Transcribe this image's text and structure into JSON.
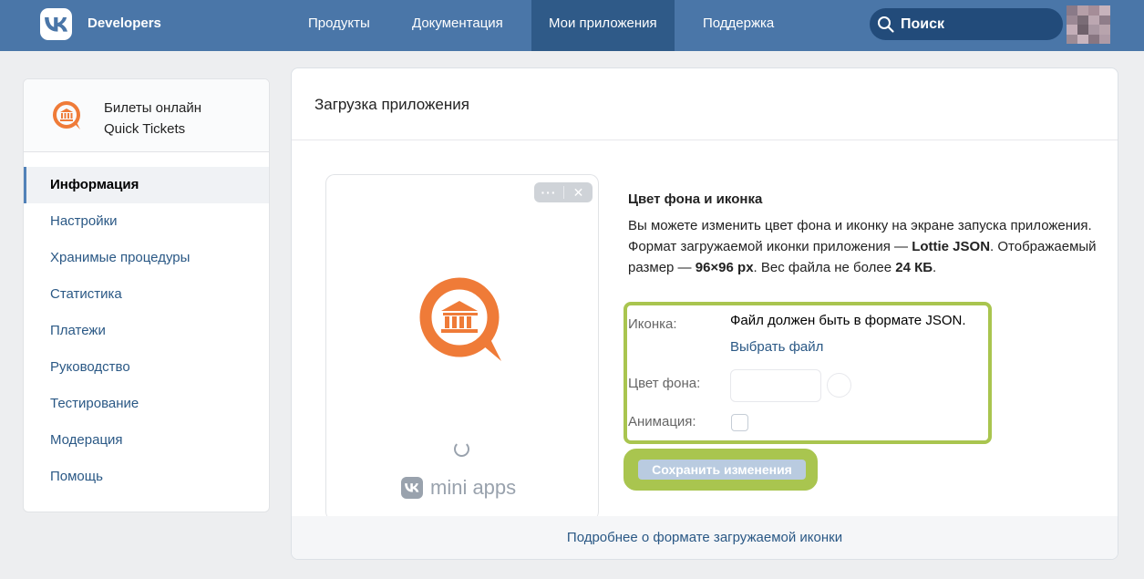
{
  "header": {
    "brand": "Developers",
    "nav": [
      {
        "label": "Продукты"
      },
      {
        "label": "Документация"
      },
      {
        "label": "Мои приложения",
        "active": true
      },
      {
        "label": "Поддержка"
      }
    ],
    "search_placeholder": "Поиск"
  },
  "sidebar": {
    "app_name_ru": "Билеты онлайн",
    "app_name_en": "Quick Tickets",
    "items": [
      {
        "label": "Информация",
        "active": true
      },
      {
        "label": "Настройки"
      },
      {
        "label": "Хранимые процедуры"
      },
      {
        "label": "Статистика"
      },
      {
        "label": "Платежи"
      },
      {
        "label": "Руководство"
      },
      {
        "label": "Тестирование"
      },
      {
        "label": "Модерация"
      },
      {
        "label": "Помощь"
      }
    ]
  },
  "main": {
    "title": "Загрузка приложения",
    "preview": {
      "more_label": "···",
      "close_label": "✕",
      "brand_text": "mini apps"
    },
    "section_title": "Цвет фона и иконка",
    "desc": {
      "part1": "Вы можете изменить цвет фона и иконку на экране запуска приложения. Формат загружаемой иконки приложения — ",
      "format": "Lottie JSON",
      "part2": ". Отображаемый размер — ",
      "size": "96×96 px",
      "part3": ". Вес файла не более ",
      "weight": "24 КБ",
      "part4": "."
    },
    "form": {
      "icon_label": "Иконка:",
      "json_note": "Файл должен быть в формате JSON.",
      "choose_file": "Выбрать файл",
      "bg_color_label": "Цвет фона:",
      "animation_label": "Анимация:",
      "animation_checked": false
    },
    "save_button": "Сохранить изменения",
    "footer_link": "Подробнее о формате загружаемой иконки"
  },
  "colors": {
    "header": "#4a76a8",
    "accent_orange": "#ef7b38",
    "link": "#2a5885",
    "highlight": "#a9c54f"
  }
}
